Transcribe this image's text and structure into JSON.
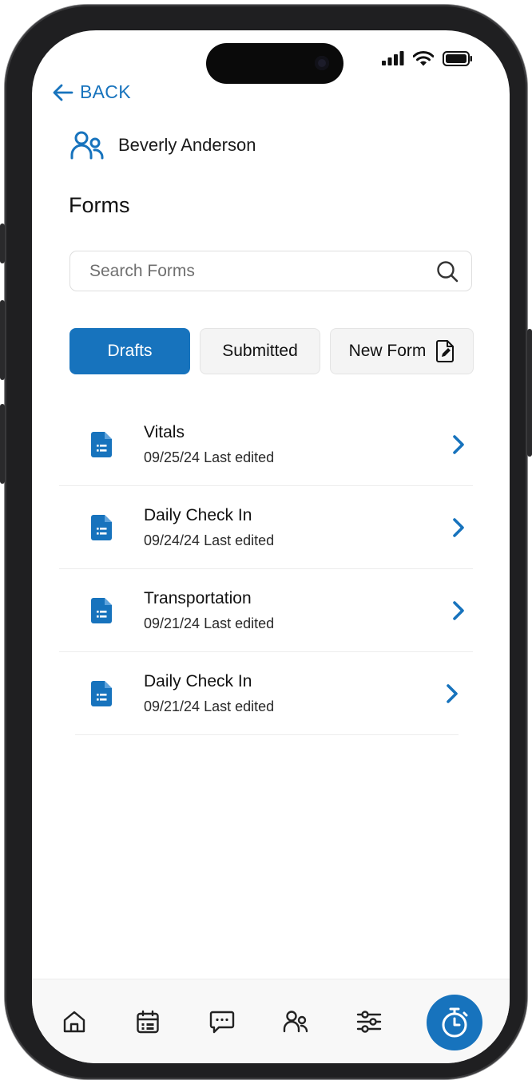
{
  "header": {
    "back_label": "BACK"
  },
  "client": {
    "name": "Beverly Anderson"
  },
  "page": {
    "title": "Forms"
  },
  "search": {
    "placeholder": "Search Forms"
  },
  "tabs": [
    {
      "label": "Drafts",
      "active": true
    },
    {
      "label": "Submitted",
      "active": false
    },
    {
      "label": "New Form",
      "active": false
    }
  ],
  "forms": [
    {
      "name": "Vitals",
      "date": "09/25/24 Last edited"
    },
    {
      "name": "Daily Check In",
      "date": "09/24/24 Last edited"
    },
    {
      "name": "Transportation",
      "date": "09/21/24 Last edited"
    },
    {
      "name": "Daily Check In",
      "date": "09/21/24 Last edited"
    }
  ],
  "bottom_nav": {
    "items": [
      "home-icon",
      "calendar-icon",
      "messages-icon",
      "clients-icon",
      "settings-sliders-icon"
    ],
    "fab_icon": "timer-icon"
  },
  "colors": {
    "accent": "#1773bd",
    "text": "#111111",
    "muted": "#6f6f6f"
  }
}
